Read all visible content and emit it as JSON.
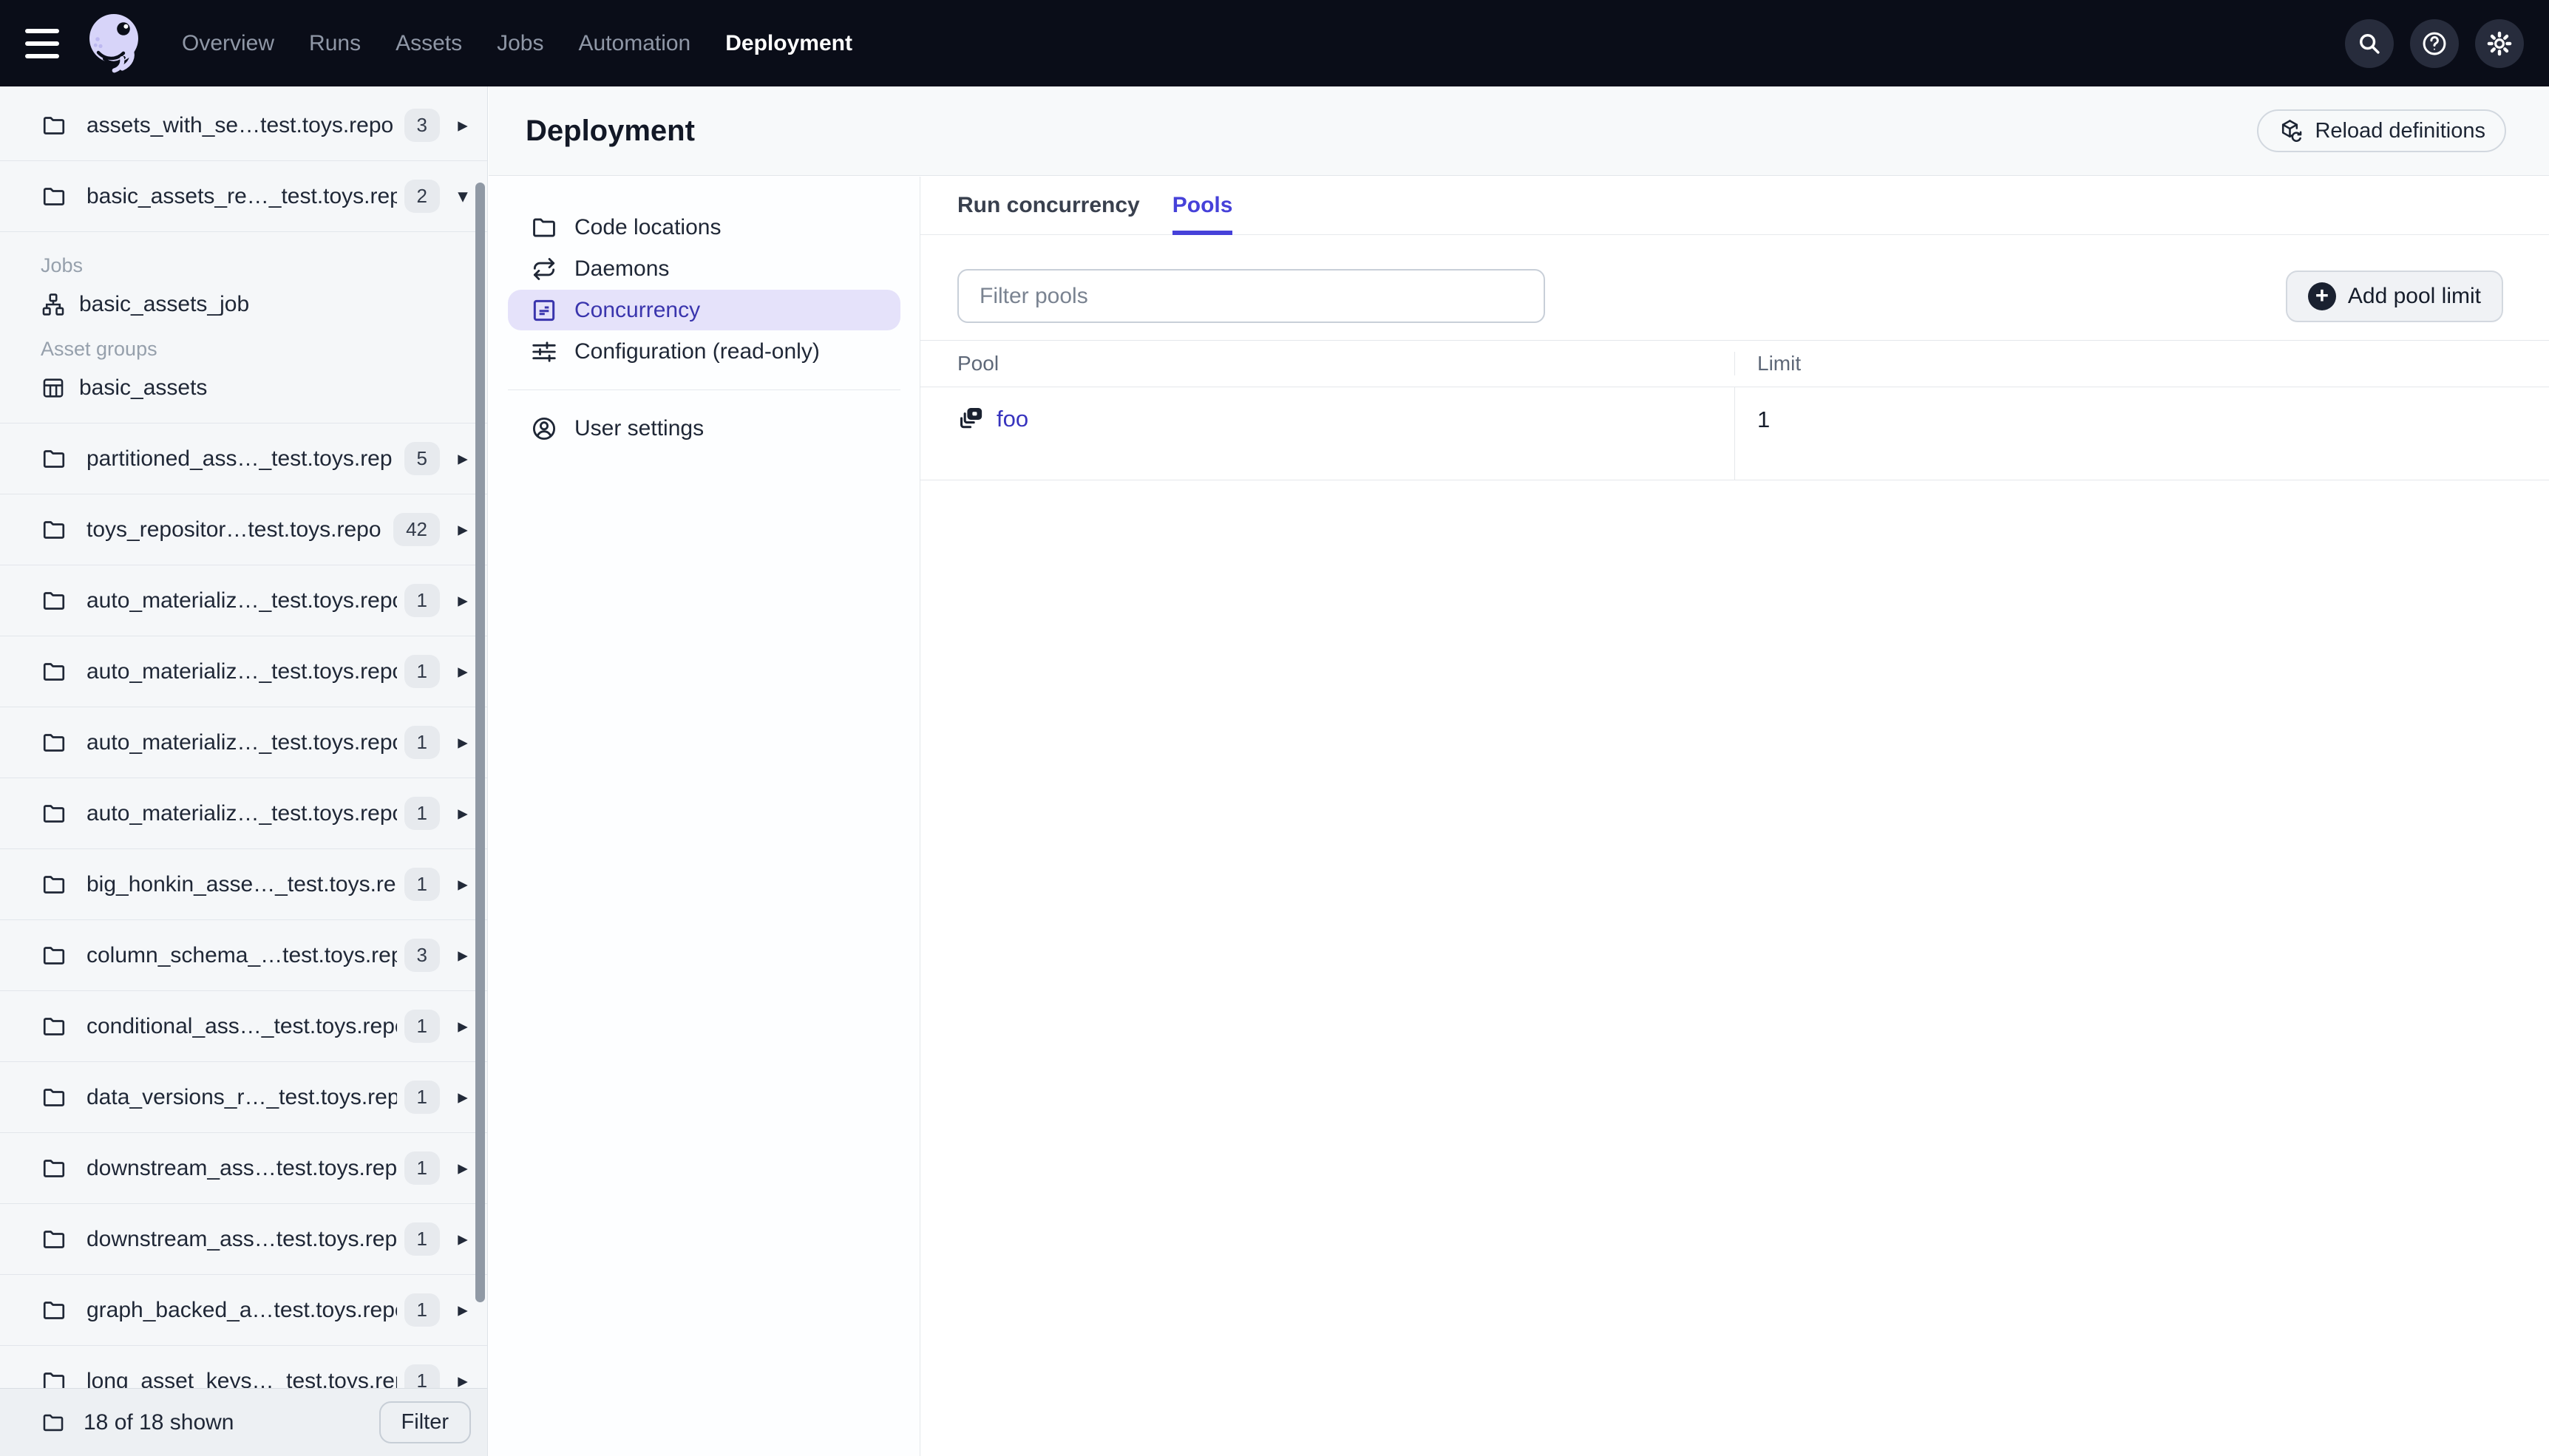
{
  "topnav": {
    "menu_icon": "hamburger-icon",
    "logo_icon": "dagster-logo",
    "links": [
      {
        "label": "Overview",
        "active": false
      },
      {
        "label": "Runs",
        "active": false
      },
      {
        "label": "Assets",
        "active": false
      },
      {
        "label": "Jobs",
        "active": false
      },
      {
        "label": "Automation",
        "active": false
      },
      {
        "label": "Deployment",
        "active": true
      }
    ],
    "action_icons": [
      {
        "name": "search-icon"
      },
      {
        "name": "help-icon"
      },
      {
        "name": "gear-icon"
      }
    ]
  },
  "sidebar": {
    "items": [
      {
        "label": "assets_with_se…test.toys.repo",
        "badge": "3",
        "expanded": false
      },
      {
        "label": "basic_assets_re…_test.toys.rep",
        "badge": "2",
        "expanded": true,
        "sections": [
          {
            "title": "Jobs",
            "entries": [
              {
                "label": "basic_assets_job",
                "icon": "job-icon"
              }
            ]
          },
          {
            "title": "Asset groups",
            "entries": [
              {
                "label": "basic_assets",
                "icon": "asset-group-icon"
              }
            ]
          }
        ]
      },
      {
        "label": "partitioned_ass…_test.toys.rep",
        "badge": "5",
        "expanded": false
      },
      {
        "label": "toys_repositor…test.toys.repo",
        "badge": "42",
        "expanded": false
      },
      {
        "label": "auto_materializ…_test.toys.repo",
        "badge": "1",
        "expanded": false
      },
      {
        "label": "auto_materializ…_test.toys.repo",
        "badge": "1",
        "expanded": false
      },
      {
        "label": "auto_materializ…_test.toys.repo",
        "badge": "1",
        "expanded": false
      },
      {
        "label": "auto_materializ…_test.toys.repo",
        "badge": "1",
        "expanded": false
      },
      {
        "label": "big_honkin_asse…_test.toys.rep",
        "badge": "1",
        "expanded": false
      },
      {
        "label": "column_schema_…test.toys.rep",
        "badge": "3",
        "expanded": false
      },
      {
        "label": "conditional_ass…_test.toys.repo",
        "badge": "1",
        "expanded": false
      },
      {
        "label": "data_versions_r…_test.toys.rep",
        "badge": "1",
        "expanded": false
      },
      {
        "label": "downstream_ass…test.toys.rep",
        "badge": "1",
        "expanded": false
      },
      {
        "label": "downstream_ass…test.toys.rep",
        "badge": "1",
        "expanded": false
      },
      {
        "label": "graph_backed_a…test.toys.repo",
        "badge": "1",
        "expanded": false
      },
      {
        "label": "long_asset_keys…_test.toys.rep",
        "badge": "1",
        "expanded": false
      }
    ],
    "footer": {
      "count_text": "18 of 18 shown",
      "filter_label": "Filter"
    }
  },
  "page": {
    "title": "Deployment",
    "reload_label": "Reload definitions"
  },
  "subnav": {
    "items": [
      {
        "label": "Code locations",
        "icon": "folder-icon",
        "active": false
      },
      {
        "label": "Daemons",
        "icon": "daemons-icon",
        "active": false
      },
      {
        "label": "Concurrency",
        "icon": "concurrency-icon",
        "active": true
      },
      {
        "label": "Configuration (read-only)",
        "icon": "sliders-icon",
        "active": false
      }
    ],
    "secondary": [
      {
        "label": "User settings",
        "icon": "user-icon",
        "active": false
      }
    ]
  },
  "tabs": [
    {
      "label": "Run concurrency",
      "active": false
    },
    {
      "label": "Pools",
      "active": true
    }
  ],
  "pools": {
    "filter_placeholder": "Filter pools",
    "add_label": "Add pool limit",
    "columns": [
      "Pool",
      "Limit"
    ],
    "rows": [
      {
        "pool": "foo",
        "limit": "1",
        "icon": "pool-icon"
      }
    ]
  },
  "colors": {
    "accent": "#4641D9",
    "accent_bg": "#E5E2FA",
    "nav_bg": "#0A0D18",
    "link": "#3733BE",
    "badge_bg": "#E7EAEE",
    "sidebar_bg": "#F5F7F9",
    "header_bg": "#F7F9FA"
  }
}
